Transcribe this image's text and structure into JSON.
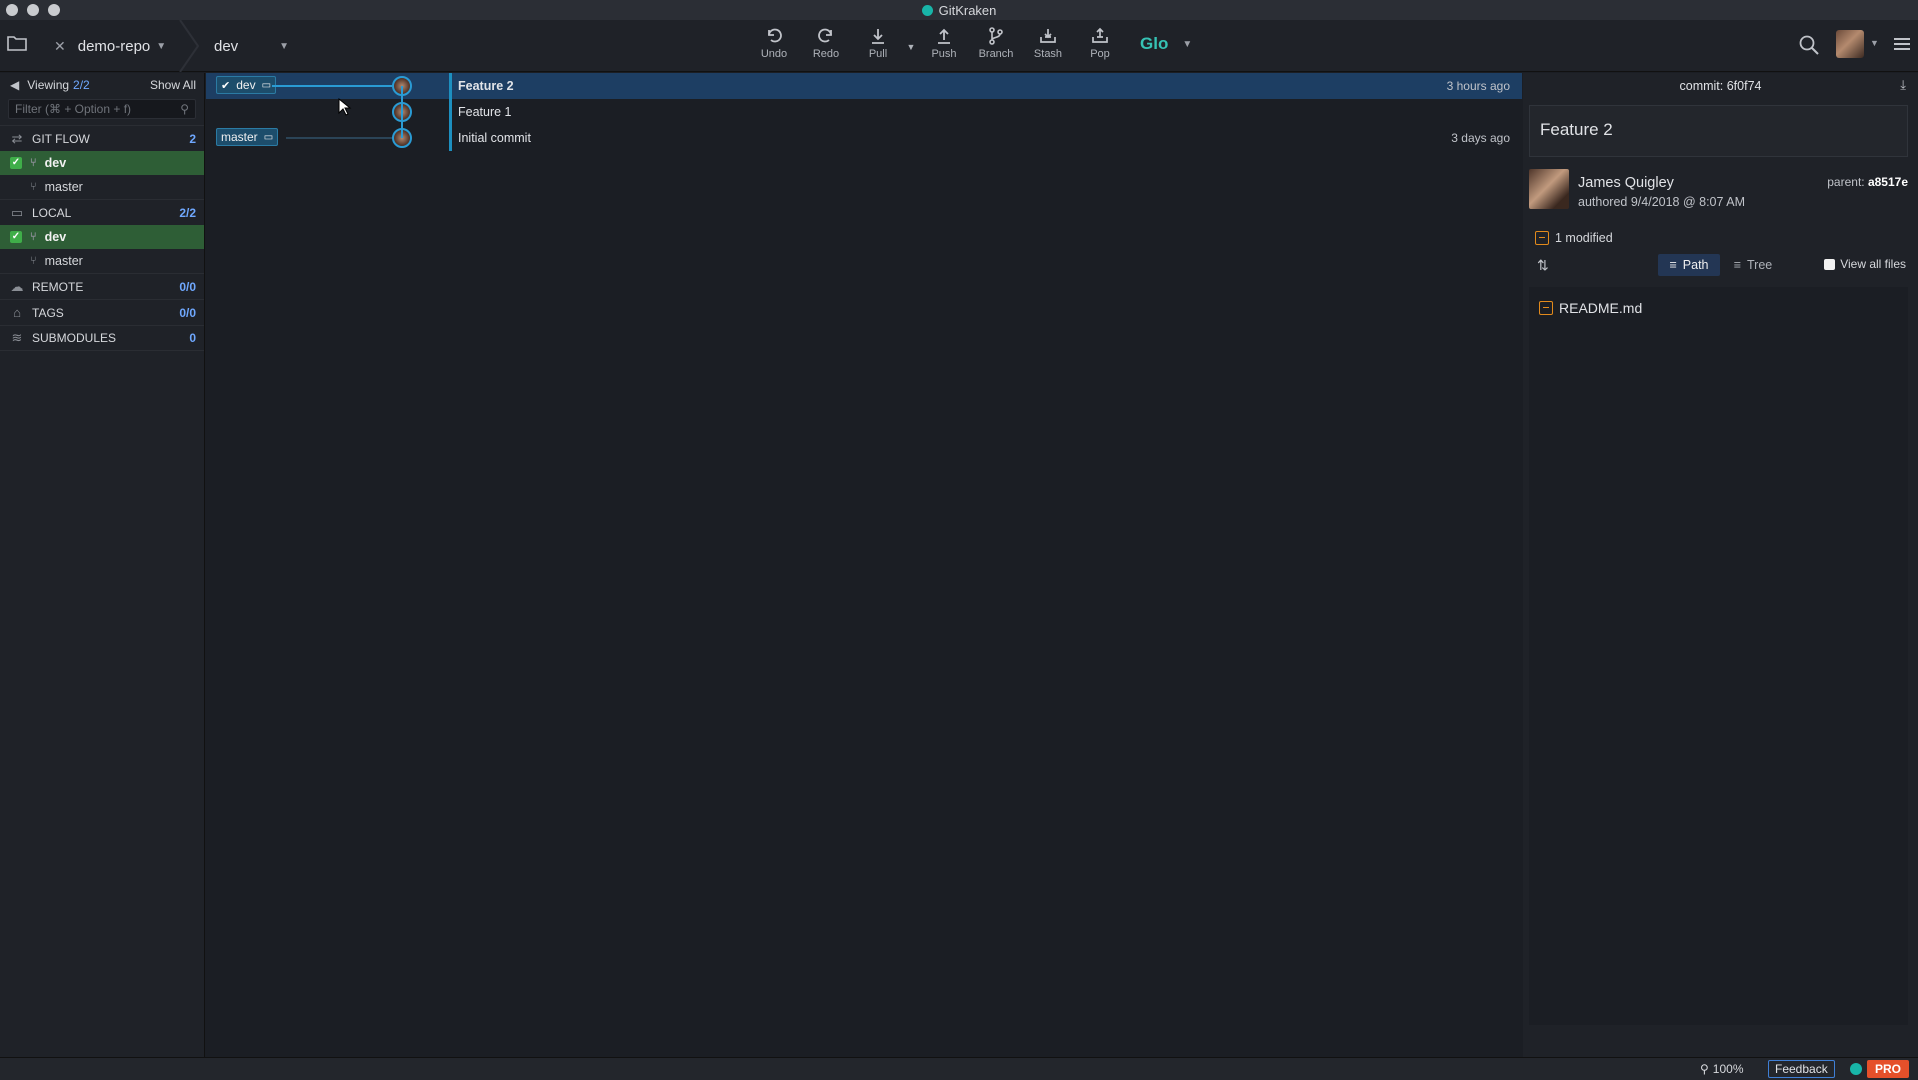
{
  "window": {
    "title": "GitKraken"
  },
  "tabs": {
    "repo": "demo-repo",
    "branch": "dev"
  },
  "toolbar": {
    "actions": [
      {
        "label": "Undo",
        "icon": "undo-icon"
      },
      {
        "label": "Redo",
        "icon": "redo-icon"
      },
      {
        "label": "Pull",
        "icon": "pull-icon"
      },
      {
        "label": "Push",
        "icon": "push-icon"
      },
      {
        "label": "Branch",
        "icon": "branch-icon"
      },
      {
        "label": "Stash",
        "icon": "stash-icon"
      },
      {
        "label": "Pop",
        "icon": "pop-icon"
      }
    ],
    "glo": "Glo"
  },
  "sidebar": {
    "viewing_label": "Viewing",
    "viewing_count": "2/2",
    "show_all": "Show All",
    "filter_placeholder": "Filter (⌘ + Option + f)",
    "gitflow": {
      "label": "GIT FLOW",
      "count": "2",
      "items": [
        "dev",
        "master"
      ]
    },
    "local": {
      "label": "LOCAL",
      "count": "2/2",
      "items": [
        "dev",
        "master"
      ]
    },
    "remote": {
      "label": "REMOTE",
      "count": "0/0"
    },
    "tags": {
      "label": "TAGS",
      "count": "0/0"
    },
    "submodules": {
      "label": "SUBMODULES",
      "count": "0"
    }
  },
  "graph": {
    "commits": [
      {
        "message": "Feature 2",
        "time": "3 hours ago",
        "branch": "dev",
        "selected": true
      },
      {
        "message": "Feature 1",
        "time": "",
        "branch": "",
        "selected": false
      },
      {
        "message": "Initial commit",
        "time": "3 days ago",
        "branch": "master",
        "selected": false
      }
    ]
  },
  "detail": {
    "commit_label": "commit: 6f0f74",
    "summary": "Feature 2",
    "author": "James Quigley",
    "authored_word": "authored",
    "authored_date": "9/4/2018 @ 8:07 AM",
    "parent_label": "parent:",
    "parent_sha": "a8517e",
    "modified": "1 modified",
    "path_label": "Path",
    "tree_label": "Tree",
    "view_all": "View all files",
    "files": [
      "README.md"
    ]
  },
  "status": {
    "zoom": "100%",
    "feedback": "Feedback",
    "pro": "PRO"
  },
  "colors": {
    "accent": "#2a9bd4",
    "selection": "#1d3e63",
    "active_branch": "#2e5e36",
    "pro": "#e5502a",
    "glo": "#36c2b4"
  }
}
